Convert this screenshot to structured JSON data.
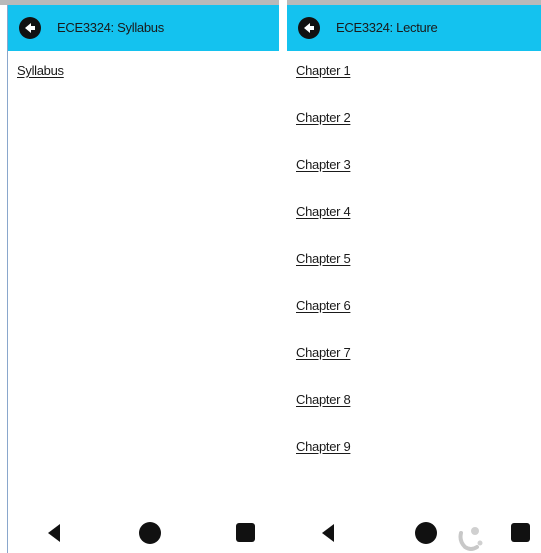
{
  "left_screen": {
    "appbar": {
      "title": "ECE3324: Syllabus"
    },
    "links": [
      {
        "label": "Syllabus"
      }
    ]
  },
  "right_screen": {
    "appbar": {
      "title": "ECE3324: Lecture"
    },
    "links": [
      {
        "label": "Chapter 1"
      },
      {
        "label": "Chapter 2"
      },
      {
        "label": "Chapter 3"
      },
      {
        "label": "Chapter 4"
      },
      {
        "label": "Chapter 5"
      },
      {
        "label": "Chapter 6"
      },
      {
        "label": "Chapter 7"
      },
      {
        "label": "Chapter 8"
      },
      {
        "label": "Chapter 9"
      }
    ]
  },
  "colors": {
    "appbar": "#14c2ef",
    "text": "#1a1a1a",
    "nav_icons": "#111111"
  },
  "icons": {
    "back_button": "arrow-left-circle-icon",
    "nav_back": "triangle-back-icon",
    "nav_home": "circle-home-icon",
    "nav_recent": "square-recent-icon"
  }
}
